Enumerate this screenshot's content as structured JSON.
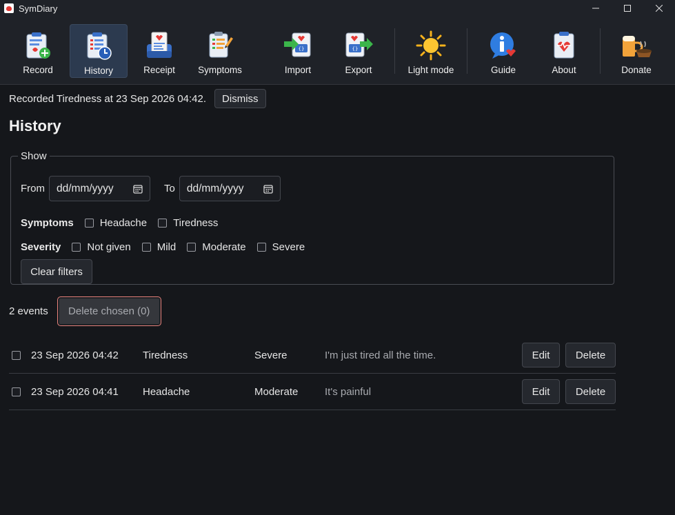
{
  "window": {
    "title": "SymDiary"
  },
  "toolbar": {
    "items": [
      {
        "label": "Record",
        "icon": "record-icon"
      },
      {
        "label": "History",
        "icon": "history-icon",
        "active": true
      },
      {
        "label": "Receipt",
        "icon": "receipt-icon"
      },
      {
        "label": "Symptoms",
        "icon": "symptoms-icon"
      },
      {
        "label": "Import",
        "icon": "import-icon"
      },
      {
        "label": "Export",
        "icon": "export-icon"
      },
      {
        "label": "Light mode",
        "icon": "sun-icon"
      },
      {
        "label": "Guide",
        "icon": "info-icon"
      },
      {
        "label": "About",
        "icon": "about-icon"
      },
      {
        "label": "Donate",
        "icon": "donate-icon"
      }
    ]
  },
  "status": {
    "message": "Recorded Tiredness at 23 Sep 2026 04:42.",
    "dismiss_label": "Dismiss"
  },
  "page": {
    "title": "History"
  },
  "filters": {
    "legend": "Show",
    "from_label": "From",
    "to_label": "To",
    "from_value": "dd/mm/yyyy",
    "to_value": "dd/mm/yyyy",
    "symptoms_label": "Symptoms",
    "symptoms": [
      "Headache",
      "Tiredness"
    ],
    "severity_label": "Severity",
    "severities": [
      "Not given",
      "Mild",
      "Moderate",
      "Severe"
    ],
    "clear_label": "Clear filters"
  },
  "events": {
    "count_label": "2 events",
    "delete_chosen_label": "Delete chosen (0)",
    "edit_label": "Edit",
    "delete_label": "Delete",
    "rows": [
      {
        "datetime": "23 Sep 2026 04:42",
        "symptom": "Tiredness",
        "severity": "Severe",
        "note": "I'm just tired all the time."
      },
      {
        "datetime": "23 Sep 2026 04:41",
        "symptom": "Headache",
        "severity": "Moderate",
        "note": "It's painful"
      }
    ]
  },
  "colors": {
    "accent_border": "#e8827c",
    "active_tab": "#2c3a4f",
    "background": "#15171b"
  }
}
